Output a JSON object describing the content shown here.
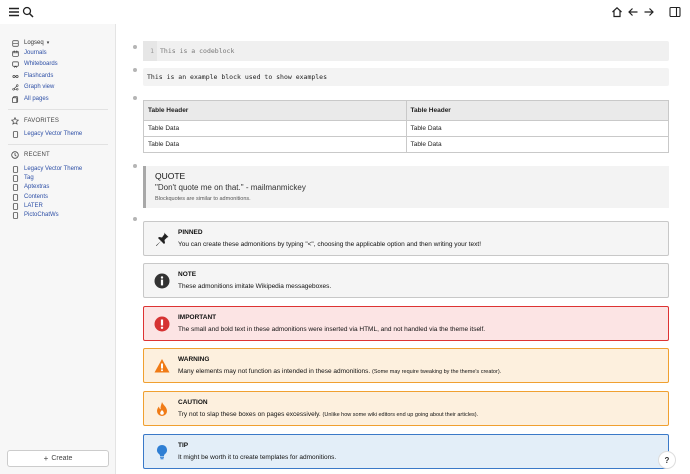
{
  "topbar": {
    "menu_icon": "menu-icon",
    "search_icon": "search-icon",
    "home_icon": "home-icon",
    "back_icon": "arrow-left-icon",
    "forward_icon": "arrow-right-icon",
    "sidebar_icon": "right-sidebar-icon"
  },
  "sidebar": {
    "graph_name": "Logseq",
    "nav": [
      {
        "label": "Journals",
        "icon": "calendar-icon"
      },
      {
        "label": "Whiteboards",
        "icon": "whiteboard-icon"
      },
      {
        "label": "Flashcards",
        "icon": "infinity-icon"
      },
      {
        "label": "Graph view",
        "icon": "graph-icon"
      },
      {
        "label": "All pages",
        "icon": "pages-icon"
      }
    ],
    "favorites_title": "FAVORITES",
    "favorites": [
      "Legacy Vector Theme"
    ],
    "recent_title": "RECENT",
    "recent": [
      "Legacy Vector Theme",
      "Tag",
      "Aptextras",
      "Contents",
      "LATER",
      "PictoChatWs"
    ],
    "create_label": "Create"
  },
  "main": {
    "code_line_number": "1",
    "code_text": "This is a codeblock",
    "example_text": "This is an example block used to show examples",
    "table": {
      "headers": [
        "Table Header",
        "Table Header"
      ],
      "rows": [
        [
          "Table Data",
          "Table Data"
        ],
        [
          "Table Data",
          "Table Data"
        ]
      ]
    },
    "quote": {
      "title": "QUOTE",
      "text": "\"Don't quote me on that.\" - mailmanmickey",
      "subtext": "Blockquotes are similar to admonitions."
    },
    "admonitions": [
      {
        "title": "PINNED",
        "text": "You can create these admonitions by typing \"<\", choosing the applicable option and then writing your text!",
        "small": "",
        "bg": "#f5f5f5",
        "border": "#c8c8c8",
        "icon": "pin-icon"
      },
      {
        "title": "NOTE",
        "text": "These admonitions imitate Wikipedia messageboxes.",
        "small": "",
        "bg": "#f5f5f5",
        "border": "#c8c8c8",
        "icon": "info-icon"
      },
      {
        "title": "IMPORTANT",
        "text": "The small and bold text in these admonitions were inserted via HTML, and not handled via the theme itself.",
        "small": "",
        "bg": "#fce4e4",
        "border": "#d33",
        "icon": "exclamation-icon"
      },
      {
        "title": "WARNING",
        "text": "Many elements may not function as intended in these admonitions.",
        "small": "(Some may require tweaking by the theme's creator).",
        "bg": "#fdf0de",
        "border": "#f0a030",
        "icon": "warning-icon"
      },
      {
        "title": "CAUTION",
        "text": "Try not to slap these boxes on pages excessively.",
        "small": "(Unlike how some wiki editors end up going about their articles).",
        "bg": "#fdf0de",
        "border": "#f0a030",
        "icon": "flame-icon"
      },
      {
        "title": "TIP",
        "text": "It might be worth it to create templates for admonitions.",
        "small": "",
        "bg": "#e3eef8",
        "border": "#3a79c8",
        "icon": "lightbulb-icon"
      }
    ]
  },
  "help_label": "?"
}
